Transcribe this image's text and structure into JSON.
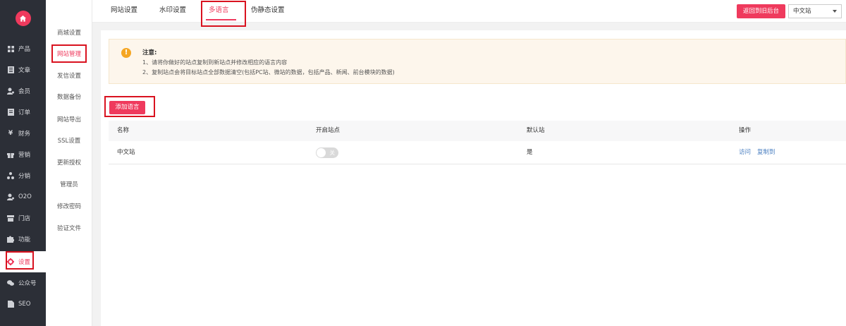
{
  "sidebar": {
    "logo_icon": "home-icon",
    "items": [
      {
        "label": "产品",
        "icon": "grid-icon"
      },
      {
        "label": "文章",
        "icon": "article-icon"
      },
      {
        "label": "会员",
        "icon": "user-icon"
      },
      {
        "label": "订单",
        "icon": "order-icon"
      },
      {
        "label": "财务",
        "icon": "yen-icon"
      },
      {
        "label": "营销",
        "icon": "gift-icon"
      },
      {
        "label": "分销",
        "icon": "network-icon"
      },
      {
        "label": "O2O",
        "icon": "users-icon"
      },
      {
        "label": "门店",
        "icon": "store-icon"
      },
      {
        "label": "功能",
        "icon": "puzzle-icon"
      },
      {
        "label": "设置",
        "icon": "gear-icon"
      },
      {
        "label": "公众号",
        "icon": "wechat-icon"
      },
      {
        "label": "SEO",
        "icon": "document-icon"
      }
    ],
    "active_index": 10
  },
  "subnav": {
    "items": [
      "商城设置",
      "网站管理",
      "发信设置",
      "数据备份",
      "网站导出",
      "SSL设置",
      "更新授权",
      "管理员",
      "修改密码",
      "验证文件"
    ],
    "active_index": 1
  },
  "tabs": {
    "items": [
      "网站设置",
      "水印设置",
      "多语言",
      "伪静态设置"
    ],
    "active_index": 2
  },
  "header": {
    "back_button": "返回到旧后台",
    "site_select_value": "中文站"
  },
  "notice": {
    "title": "注意:",
    "lines": [
      "1、请将你做好的站点复制到新站点并修改相应的语言内容",
      "2、复制站点会将目标站点全部数据清空(包括PC站、微站的数据，包括产品、新闻、前台模块的数据)"
    ]
  },
  "add_button": "添加语言",
  "table": {
    "headers": [
      "名称",
      "开启站点",
      "默认站",
      "操作"
    ],
    "rows": [
      {
        "name": "中文站",
        "toggle_text": "关",
        "toggle_on": false,
        "default": "是",
        "actions": [
          "访问",
          "复制到"
        ]
      }
    ]
  },
  "colors": {
    "accent": "#ef3a5d",
    "sidebar_bg": "#2c2f37",
    "highlight": "#d9121f",
    "link": "#4a7fc1"
  }
}
